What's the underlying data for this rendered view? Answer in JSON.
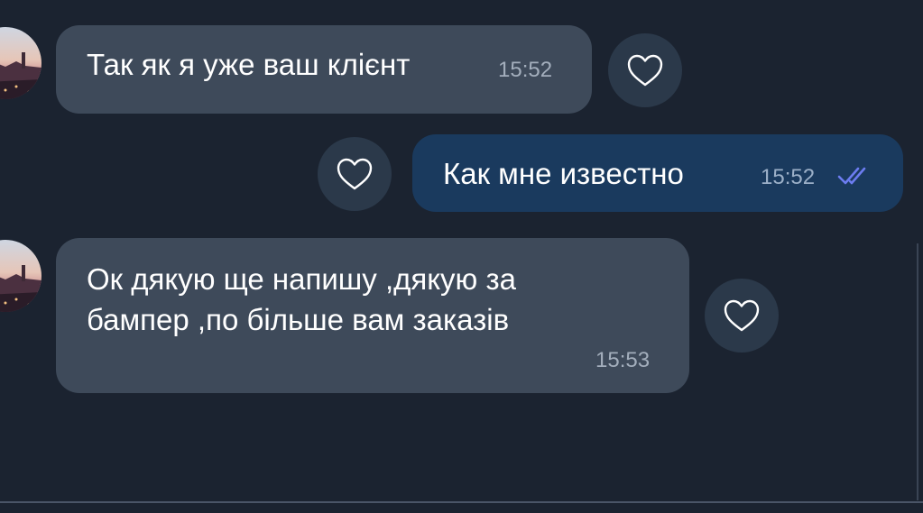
{
  "messages": [
    {
      "text": "Так як я уже ваш клієнт",
      "time": "15:52"
    },
    {
      "text": "Как мне известно",
      "time": "15:52"
    },
    {
      "text_line1": "Ок дякую ще напишу ,дякую за",
      "text_line2": "бампер ,по більше вам заказів",
      "time": "15:53"
    }
  ],
  "icons": {
    "heart": "heart-icon",
    "read_status": "double-check-icon",
    "avatar": "avatar"
  },
  "colors": {
    "background": "#1b2330",
    "incoming_bubble": "#3e4a5a",
    "outgoing_bubble": "#1a3a5e",
    "reaction_button": "#2b394a",
    "read_check": "#6c7cf0"
  }
}
